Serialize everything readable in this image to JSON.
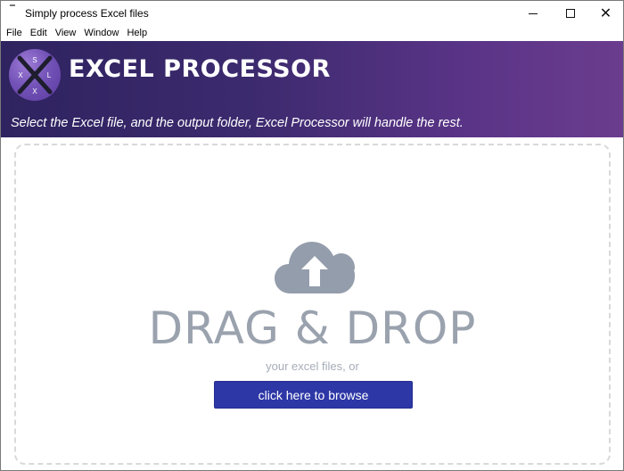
{
  "window": {
    "title": "Simply process Excel files"
  },
  "menu": {
    "items": [
      "File",
      "Edit",
      "View",
      "Window",
      "Help"
    ]
  },
  "banner": {
    "title": "EXCEL PROCESSOR",
    "subtitle": "Select the Excel file, and the output folder, Excel Processor will handle the rest.",
    "logo_letters": [
      "S",
      "X",
      "L",
      "X"
    ]
  },
  "dropzone": {
    "icon": "cloud-upload-icon",
    "title": "DRAG & DROP",
    "subtitle": "your excel files, or",
    "browse_label": "click here to browse"
  },
  "colors": {
    "banner_start": "#2f2360",
    "banner_end": "#6b3c8e",
    "browse_button": "#2d37a6",
    "drop_text": "#9aa2ae"
  }
}
